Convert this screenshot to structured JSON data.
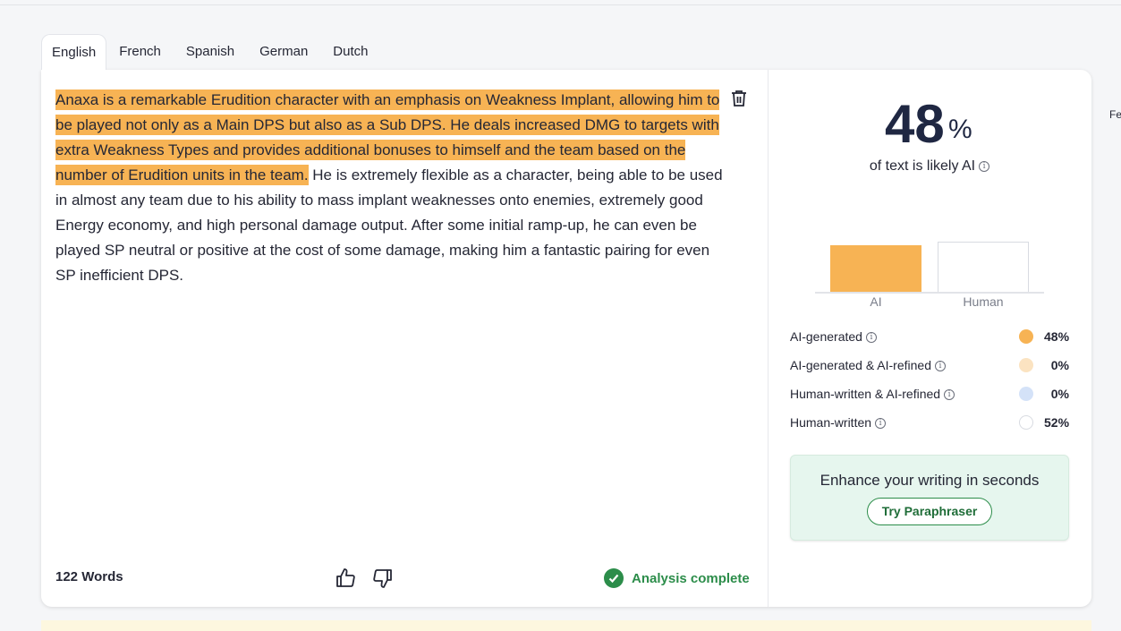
{
  "tabs": [
    "English",
    "French",
    "Spanish",
    "German",
    "Dutch"
  ],
  "edge_text": "Fe",
  "editor": {
    "highlighted_text": "Anaxa is a remarkable Erudition character with an emphasis on Weakness Implant, allowing him to be played not only as a Main DPS but also as a Sub DPS. He deals increased DMG to targets with extra Weakness Types and provides additional bonuses to himself and the team based on the number of Erudition units in the team.",
    "plain_text": " He is extremely flexible as a character, being able to be used in almost any team due to his ability to mass implant weaknesses onto enemies, extremely good Energy economy, and high personal damage output. After some initial ramp-up, he can even be played SP neutral or positive at the cost of some damage, making him a fantastic pairing for even SP inefficient DPS.",
    "word_count": "122 Words",
    "status": "Analysis complete",
    "highlight_color": "#f7b354"
  },
  "result": {
    "percent_value": "48",
    "percent_sign": "%",
    "caption": "of text is likely AI",
    "info_glyph": "i"
  },
  "chart_data": {
    "type": "bar",
    "categories": [
      "AI",
      "Human"
    ],
    "values": [
      48,
      52
    ],
    "ylim": [
      0,
      100
    ],
    "colors": [
      "#f7b354",
      "#ffffff"
    ]
  },
  "legend": [
    {
      "label": "AI-generated",
      "value": "48%",
      "color": "#f7b354"
    },
    {
      "label": "AI-generated & AI-refined",
      "value": "0%",
      "color": "#fbe3c1"
    },
    {
      "label": "Human-written & AI-refined",
      "value": "0%",
      "color": "#d4e2f8"
    },
    {
      "label": "Human-written",
      "value": "52%",
      "color": "#ffffff"
    }
  ],
  "promo": {
    "title": "Enhance your writing in seconds",
    "button": "Try Paraphraser"
  },
  "colors": {
    "accent_green": "#2c8d4a",
    "ai_orange": "#f7b354",
    "promo_bg": "#e6f6ee"
  }
}
